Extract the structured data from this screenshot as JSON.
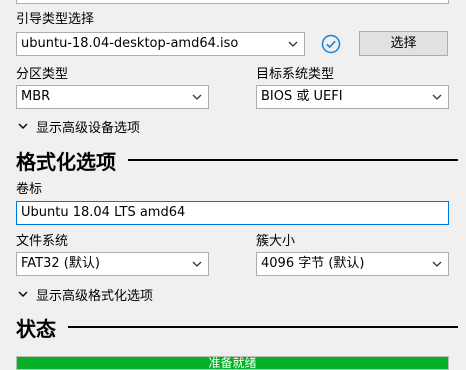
{
  "boot_selection": {
    "label": "引导类型选择",
    "value": "ubuntu-18.04-desktop-amd64.iso",
    "select_button": "选择",
    "check_icon": "check-circle-icon"
  },
  "partition_scheme": {
    "label": "分区类型",
    "value": "MBR"
  },
  "target_system": {
    "label": "目标系统类型",
    "value": "BIOS 或 UEFI"
  },
  "advanced_device": {
    "label": "显示高级设备选项"
  },
  "format_options": {
    "title": "格式化选项"
  },
  "volume_label": {
    "label": "卷标",
    "value": "Ubuntu 18.04 LTS amd64"
  },
  "file_system": {
    "label": "文件系统",
    "value": "FAT32 (默认)"
  },
  "cluster_size": {
    "label": "簇大小",
    "value": "4096 字节 (默认)"
  },
  "advanced_format": {
    "label": "显示高级格式化选项"
  },
  "status": {
    "title": "状态",
    "progress_text": "准备就绪",
    "progress_fraction": 1.0
  },
  "colors": {
    "accent": "#0078d7",
    "progress": "#06b025"
  }
}
